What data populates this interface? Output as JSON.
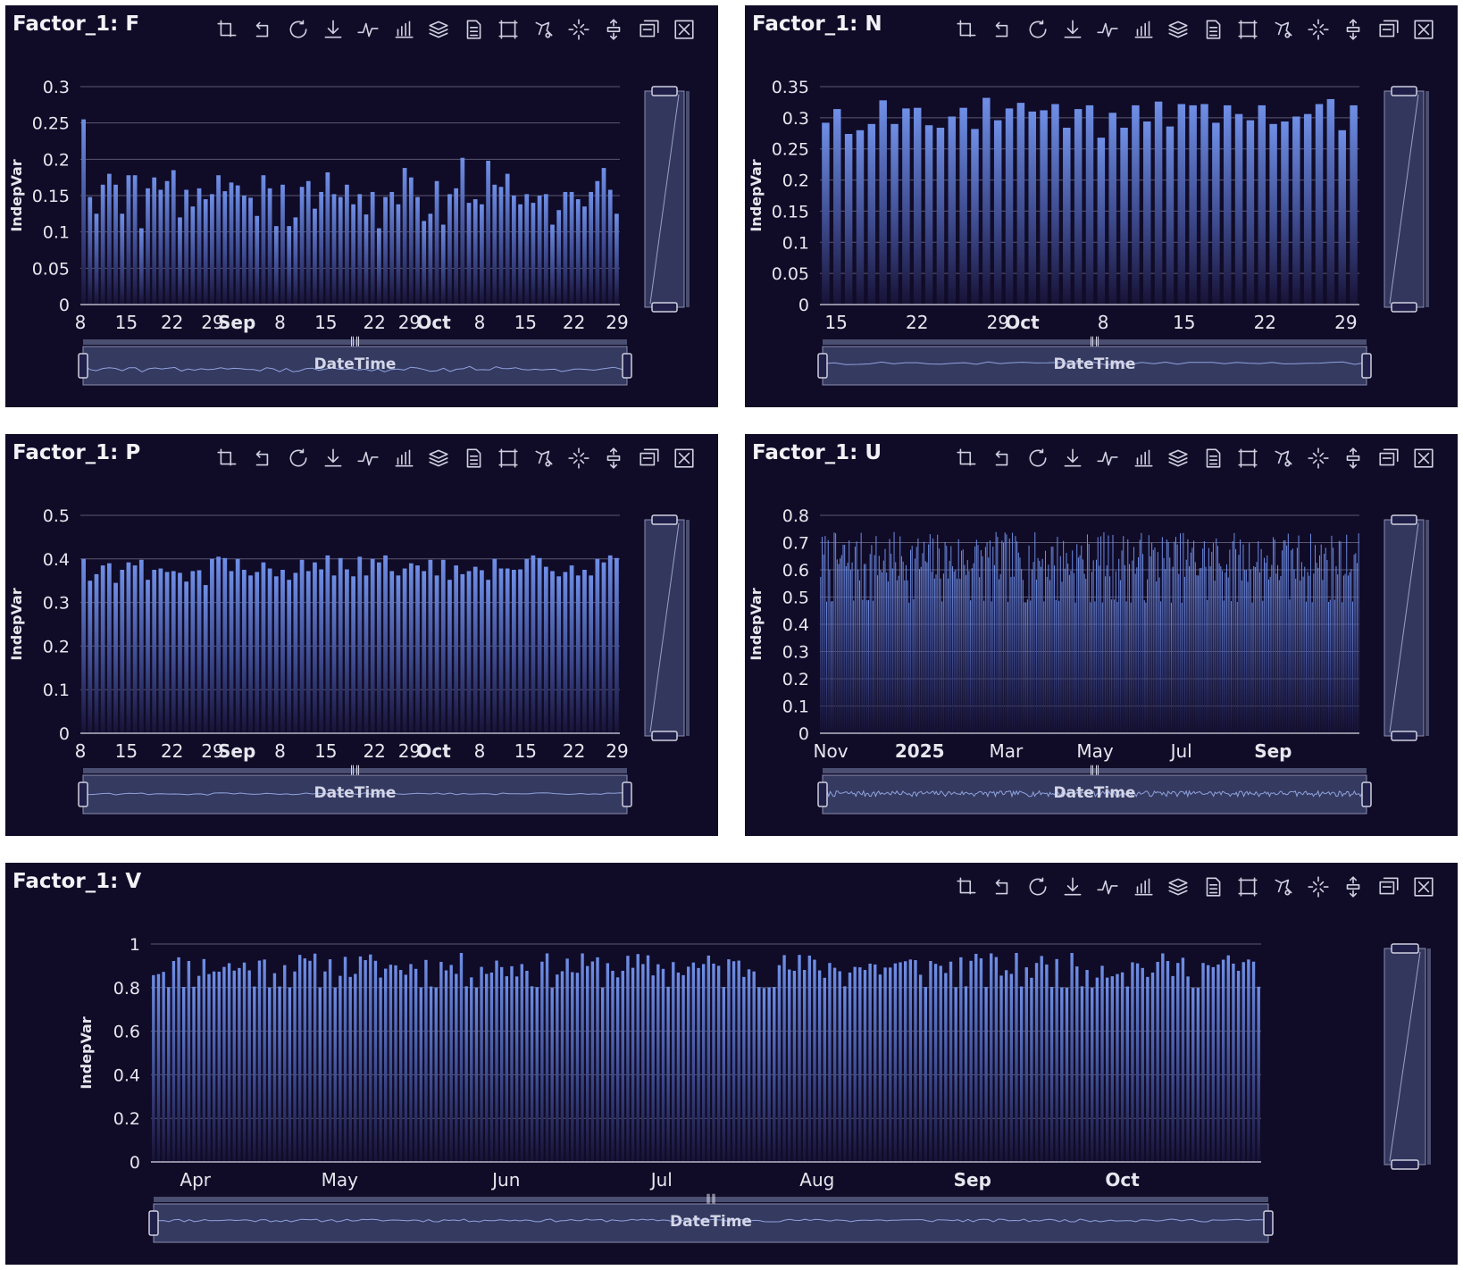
{
  "colors": {
    "panel_bg": "#100b27",
    "bar_top": "#6f8fe6",
    "bar_bottom": "#171236",
    "grid": "#5a5870",
    "text": "#e6e6ee",
    "slider_fill": "#3a3f68",
    "slider_border": "#8a8fb0",
    "mini_line": "#8fa2dc"
  },
  "toolbar": {
    "icons": [
      "crop-icon",
      "undo-icon",
      "refresh-icon",
      "download-icon",
      "line-chart-icon",
      "bar-chart-icon",
      "stack-icon",
      "document-icon",
      "rect-select-icon",
      "lasso-select-icon",
      "keep-select-icon",
      "clear-select-icon",
      "dataview-icon",
      "close-icon"
    ]
  },
  "chart_data": [
    {
      "id": "F",
      "type": "bar",
      "title": "Factor_1: F",
      "ylabel": "IndepVar",
      "slider_label": "DateTime",
      "ylim": [
        0,
        0.3
      ],
      "yticks": [
        "0",
        "0.05",
        "0.1",
        "0.15",
        "0.2",
        "0.25",
        "0.3"
      ],
      "grid": true,
      "xticks": [
        "8",
        "15",
        "22",
        "29",
        "Sep",
        "8",
        "15",
        "22",
        "29",
        "Oct",
        "8",
        "15",
        "22",
        "29"
      ],
      "values": [
        0.255,
        0.148,
        0.125,
        0.165,
        0.18,
        0.165,
        0.125,
        0.178,
        0.178,
        0.105,
        0.16,
        0.175,
        0.158,
        0.17,
        0.185,
        0.12,
        0.158,
        0.135,
        0.16,
        0.145,
        0.152,
        0.178,
        0.156,
        0.168,
        0.164,
        0.15,
        0.147,
        0.122,
        0.178,
        0.16,
        0.108,
        0.165,
        0.108,
        0.12,
        0.162,
        0.17,
        0.132,
        0.155,
        0.182,
        0.152,
        0.148,
        0.165,
        0.138,
        0.152,
        0.124,
        0.155,
        0.105,
        0.148,
        0.155,
        0.138,
        0.188,
        0.175,
        0.148,
        0.115,
        0.125,
        0.17,
        0.11,
        0.152,
        0.16,
        0.202,
        0.14,
        0.145,
        0.138,
        0.198,
        0.165,
        0.162,
        0.18,
        0.15,
        0.138,
        0.152,
        0.14,
        0.15,
        0.152,
        0.11,
        0.13,
        0.155,
        0.155,
        0.145,
        0.135,
        0.155,
        0.17,
        0.188,
        0.158,
        0.125
      ]
    },
    {
      "id": "N",
      "type": "bar",
      "title": "Factor_1: N",
      "ylabel": "IndepVar",
      "slider_label": "DateTime",
      "ylim": [
        0,
        0.35
      ],
      "yticks": [
        "0",
        "0.05",
        "0.1",
        "0.15",
        "0.2",
        "0.25",
        "0.3",
        "0.35"
      ],
      "grid": true,
      "xticks": [
        "15",
        "22",
        "29",
        "Oct",
        "8",
        "15",
        "22",
        "29"
      ],
      "values": [
        0.292,
        0.314,
        0.274,
        0.28,
        0.29,
        0.328,
        0.29,
        0.315,
        0.316,
        0.288,
        0.284,
        0.302,
        0.316,
        0.282,
        0.332,
        0.296,
        0.315,
        0.324,
        0.31,
        0.312,
        0.322,
        0.284,
        0.314,
        0.32,
        0.268,
        0.308,
        0.284,
        0.32,
        0.294,
        0.326,
        0.286,
        0.322,
        0.32,
        0.322,
        0.292,
        0.32,
        0.306,
        0.296,
        0.32,
        0.29,
        0.294,
        0.302,
        0.306,
        0.322,
        0.33,
        0.28,
        0.32
      ]
    },
    {
      "id": "P",
      "type": "bar",
      "title": "Factor_1: P",
      "ylabel": "IndepVar",
      "slider_label": "DateTime",
      "ylim": [
        0,
        0.5
      ],
      "yticks": [
        "0",
        "0.1",
        "0.2",
        "0.3",
        "0.4",
        "0.5"
      ],
      "grid": true,
      "xticks": [
        "8",
        "15",
        "22",
        "29",
        "Sep",
        "8",
        "15",
        "22",
        "29",
        "Oct",
        "8",
        "15",
        "22",
        "29"
      ],
      "values": [
        0.4,
        0.35,
        0.365,
        0.385,
        0.39,
        0.345,
        0.375,
        0.392,
        0.385,
        0.398,
        0.352,
        0.375,
        0.378,
        0.37,
        0.372,
        0.368,
        0.348,
        0.372,
        0.374,
        0.34,
        0.4,
        0.405,
        0.402,
        0.372,
        0.4,
        0.375,
        0.362,
        0.37,
        0.392,
        0.378,
        0.36,
        0.375,
        0.352,
        0.368,
        0.398,
        0.372,
        0.392,
        0.376,
        0.408,
        0.362,
        0.402,
        0.376,
        0.36,
        0.405,
        0.362,
        0.4,
        0.392,
        0.408,
        0.372,
        0.362,
        0.378,
        0.39,
        0.385,
        0.372,
        0.398,
        0.362,
        0.398,
        0.352,
        0.385,
        0.365,
        0.372,
        0.382,
        0.374,
        0.352,
        0.4,
        0.378,
        0.378,
        0.375,
        0.376,
        0.4,
        0.408,
        0.402,
        0.382,
        0.372,
        0.36,
        0.37,
        0.385,
        0.362,
        0.375,
        0.362,
        0.4,
        0.392,
        0.408,
        0.402
      ]
    },
    {
      "id": "U",
      "type": "bar",
      "title": "Factor_1: U",
      "ylabel": "IndepVar",
      "slider_label": "DateTime",
      "ylim": [
        0,
        0.8
      ],
      "yticks": [
        "0",
        "0.1",
        "0.2",
        "0.3",
        "0.4",
        "0.5",
        "0.6",
        "0.7",
        "0.8"
      ],
      "grid": true,
      "xticks": [
        "Nov",
        "2025",
        "Mar",
        "May",
        "Jul",
        "Sep"
      ],
      "n_points": 360,
      "value_range": [
        0.45,
        0.74
      ]
    },
    {
      "id": "V",
      "type": "bar",
      "title": "Factor_1: V",
      "ylabel": "IndepVar",
      "slider_label": "DateTime",
      "ylim": [
        0,
        1
      ],
      "yticks": [
        "0",
        "0.2",
        "0.4",
        "0.6",
        "0.8",
        "1"
      ],
      "grid": true,
      "xticks": [
        "Apr",
        "May",
        "Jun",
        "Jul",
        "Aug",
        "Sep",
        "Oct"
      ],
      "n_points": 220,
      "value_range": [
        0.78,
        0.96
      ]
    }
  ]
}
